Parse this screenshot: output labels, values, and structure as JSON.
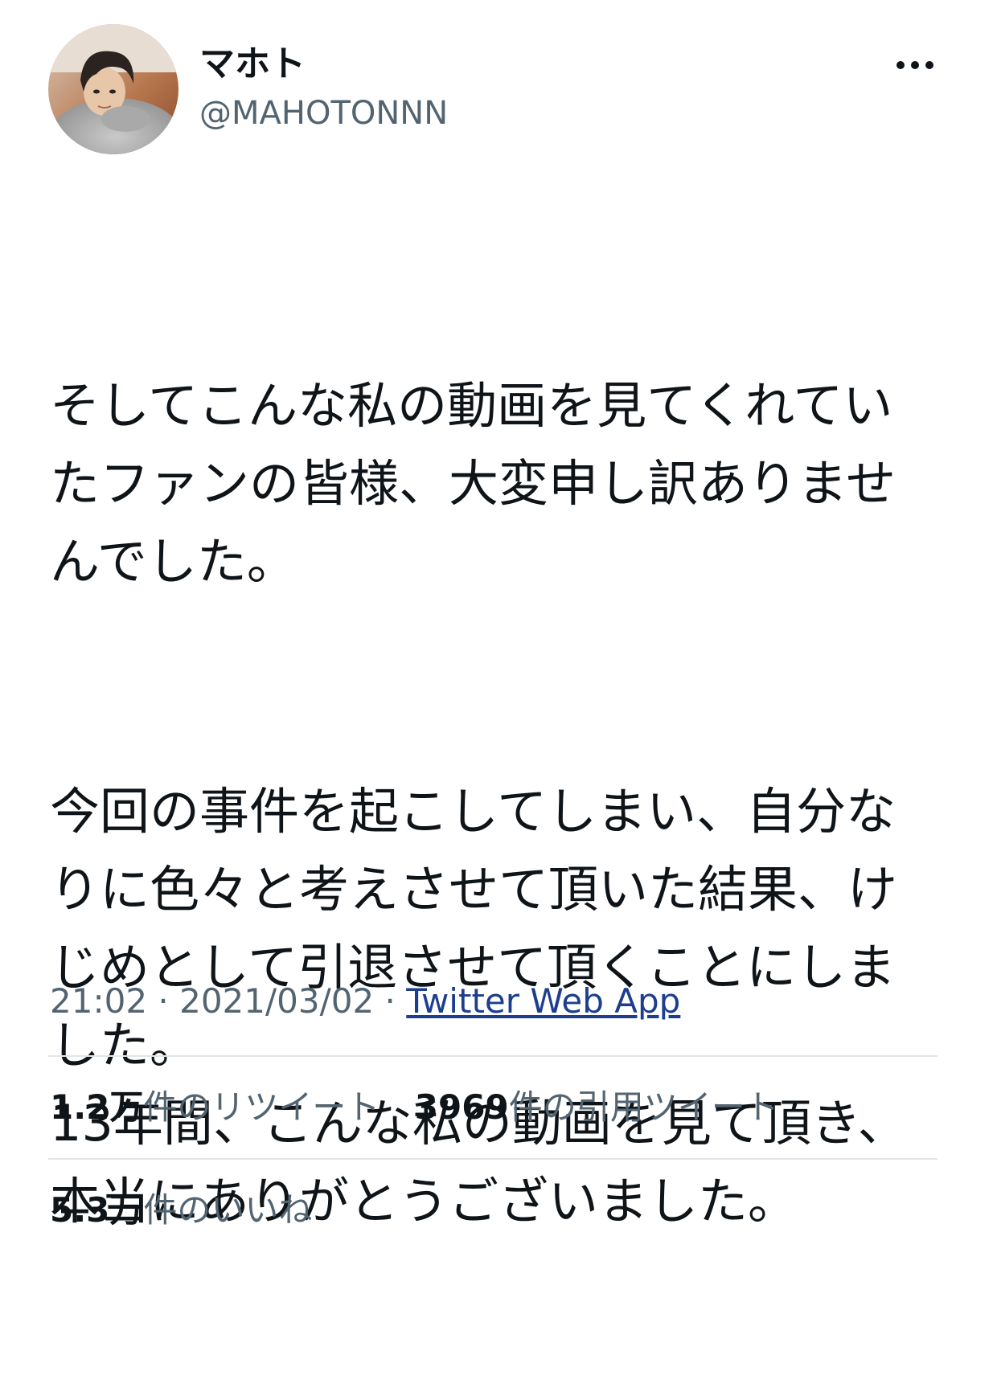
{
  "author": {
    "display_name": "マホト",
    "handle": "@MAHOTONNN",
    "avatar": "profile-photo"
  },
  "more_icon": "ellipsis-icon",
  "tweet": {
    "paragraphs": [
      "そしてこんな私の動画を見てくれていたファンの皆様、大変申し訳ありませんでした。",
      "今回の事件を起こしてしまい、自分なりに色々と考えさせて頂いた結果、けじめとして引退させて頂くことにしました。\n13年間、こんな私の動画を見て頂き、本当にありがとうございました。"
    ],
    "time": "21:02",
    "date": "2021/03/02",
    "separator": " · ",
    "source": "Twitter Web App"
  },
  "stats": {
    "retweets": {
      "count": "1.2万",
      "label": "件のリツイート"
    },
    "quotes": {
      "count": "3969",
      "label": "件の引用ツイート"
    },
    "likes": {
      "count": "5.3万",
      "label": "件のいいね"
    }
  },
  "colors": {
    "text": "#0f1419",
    "secondary": "#536471",
    "link": "#1d3d8f",
    "divider": "#e3e6e9"
  }
}
